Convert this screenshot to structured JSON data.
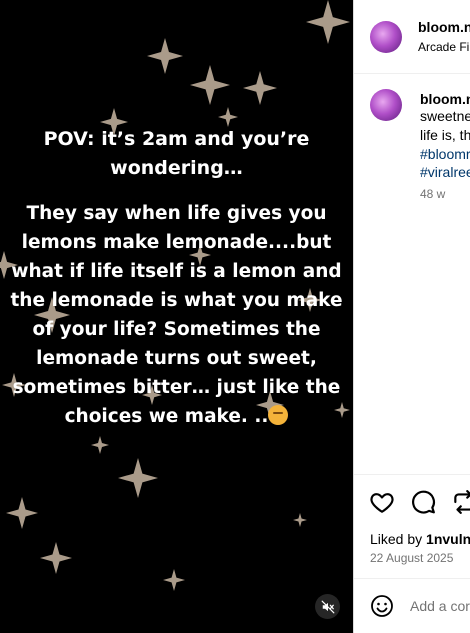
{
  "media": {
    "pov_text": "POV: it’s 2am and you’re wondering…",
    "body_lines": [
      "They say when life gives you",
      "lemons make lemonade....but",
      "what if life itself is a lemon and",
      "the lemonade is what you make",
      "of your life? Sometimes the",
      "lemonade turns out sweet,",
      "sometimes bitter… just like the",
      "choices we make. .."
    ],
    "emoji_icon": "thinking-face-emoji",
    "mute_icon": "muted-speaker-icon"
  },
  "header": {
    "username": "bloom.n",
    "subtitle": "Arcade Fir"
  },
  "caption": {
    "username": "bloom.n",
    "line1": "sweetne",
    "line2": "life is, th",
    "hashtag1": "#bloomr",
    "hashtag2": "#viralree",
    "time": "48 w"
  },
  "actions": {
    "like_icon": "heart-icon",
    "comment_icon": "comment-icon",
    "share_icon": "share-icon"
  },
  "likes": {
    "prefix": "Liked by ",
    "user": "1nvulne"
  },
  "post_date": "22 August 2025",
  "comment_box": {
    "placeholder": "Add a cor",
    "emoji_icon": "smiley-icon"
  },
  "colors": {
    "media_bg": "#000000",
    "sparkle": "#c9b7a3",
    "hashtag": "#00376b",
    "muted_text": "#737373"
  }
}
